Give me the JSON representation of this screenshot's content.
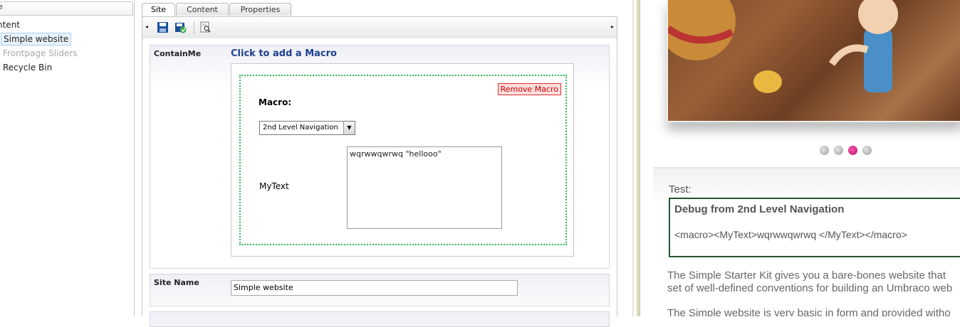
{
  "tree": {
    "header_text": "e",
    "root_label": "ntent",
    "items": [
      "Simple website",
      "Frontpage Sliders",
      "Recycle Bin"
    ]
  },
  "tabs": [
    "Site",
    "Content",
    "Properties"
  ],
  "toolbar": {
    "icons": [
      "save-icon",
      "save-publish-icon",
      "preview-icon"
    ],
    "left_arrow": "◂",
    "right_arrow": "▸"
  },
  "properties": {
    "containme": {
      "label": "ContainMe",
      "add_macro_link": "Click to add a Macro",
      "remove_macro": "Remove Macro",
      "macro_title": "Macro:",
      "macro_selected": "2nd Level Navigation",
      "mytext_label": "MyText",
      "mytext_value": "wqrwwqwrwq \"hellooo\""
    },
    "site_name": {
      "label": "Site Name",
      "value": "Simple website"
    }
  },
  "preview": {
    "slider_dots": 4,
    "active_dot": 3,
    "test_label": "Test:",
    "debug_title": "Debug from 2nd Level Navigation",
    "debug_body": "<macro><MyText>wqrwwqwrwq </MyText></macro>",
    "para1_line1": "The Simple Starter Kit gives you a bare-bones website that",
    "para1_line2": "set of well-defined conventions for building an Umbraco web",
    "para2_line1": "The Simple website is very basic in form and provided witho"
  },
  "colors": {
    "accent_link": "#1f3f8f",
    "macro_border": "#2fbf4f",
    "remove_macro": "#cc0000",
    "active_dot": "#d0107a",
    "debug_border": "#225530"
  }
}
